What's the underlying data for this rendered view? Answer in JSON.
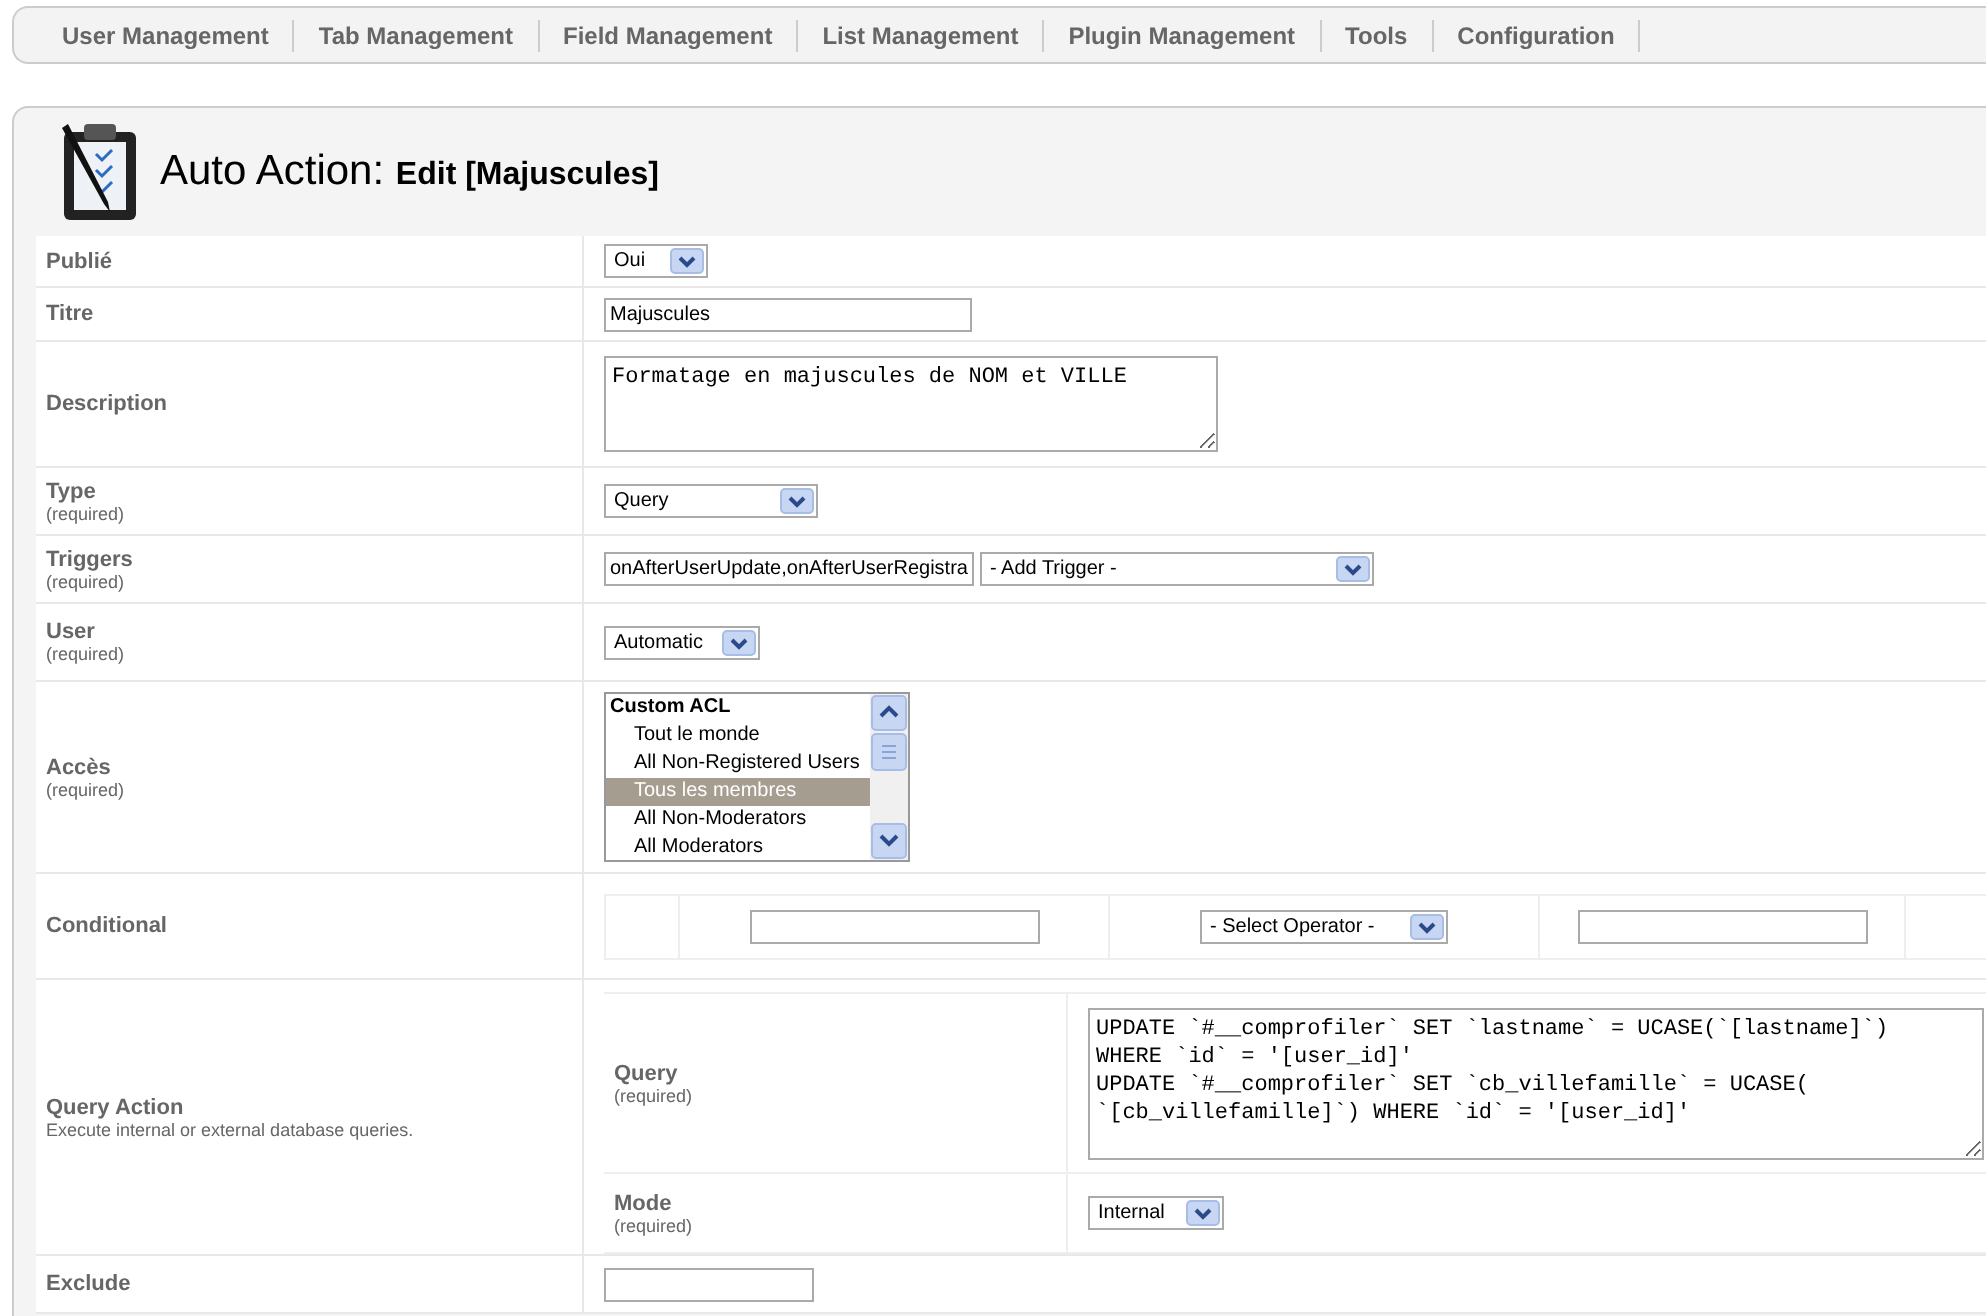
{
  "nav": [
    "User Management",
    "Tab Management",
    "Field Management",
    "List Management",
    "Plugin Management",
    "Tools",
    "Configuration"
  ],
  "header": {
    "title": "Auto Action:",
    "subtitle": "Edit [Majuscules]"
  },
  "form": [
    {
      "kind": "select",
      "label": "Publié",
      "value": "Oui"
    },
    {
      "kind": "text",
      "label": "Titre",
      "value": "Majuscules"
    },
    {
      "kind": "textarea",
      "label": "Description",
      "value": "Formatage en majuscules de NOM et VILLE"
    },
    {
      "kind": "select",
      "label": "Type",
      "required": "(required)",
      "value": "Query"
    },
    {
      "kind": "triggers",
      "label": "Triggers",
      "required": "(required)",
      "value": "onAfterUserUpdate,onAfterUserRegistra",
      "add": "- Add Trigger -"
    },
    {
      "kind": "select",
      "label": "User",
      "required": "(required)",
      "value": "Automatic"
    },
    {
      "kind": "listbox",
      "label": "Accès",
      "required": "(required)",
      "options": [
        {
          "kind": "group",
          "label": "Custom ACL",
          "selected": false
        },
        {
          "kind": "option",
          "label": "Tout le monde",
          "selected": false
        },
        {
          "kind": "option",
          "label": "All Non-Registered Users",
          "selected": false
        },
        {
          "kind": "option",
          "label": "Tous les membres",
          "selected": true
        },
        {
          "kind": "option",
          "label": "All Non-Moderators",
          "selected": false
        },
        {
          "kind": "option",
          "label": "All Moderators",
          "selected": false
        }
      ]
    },
    {
      "kind": "conditional",
      "label": "Conditional",
      "operator": "- Select Operator -"
    },
    {
      "kind": "query",
      "label": "Query Action",
      "description": "Execute internal or external database queries.",
      "fields": [
        {
          "kind": "code",
          "label": "Query",
          "required": "(required)",
          "value": "UPDATE `#__comprofiler` SET `lastname` = UCASE(`[lastname]`)\nWHERE `id` = '[user_id]'\nUPDATE `#__comprofiler` SET `cb_villefamille` = UCASE(\n`[cb_villefamille]`) WHERE `id` = '[user_id]'"
        },
        {
          "kind": "select",
          "label": "Mode",
          "required": "(required)",
          "value": "Internal"
        }
      ]
    },
    {
      "kind": "text",
      "label": "Exclude"
    }
  ]
}
